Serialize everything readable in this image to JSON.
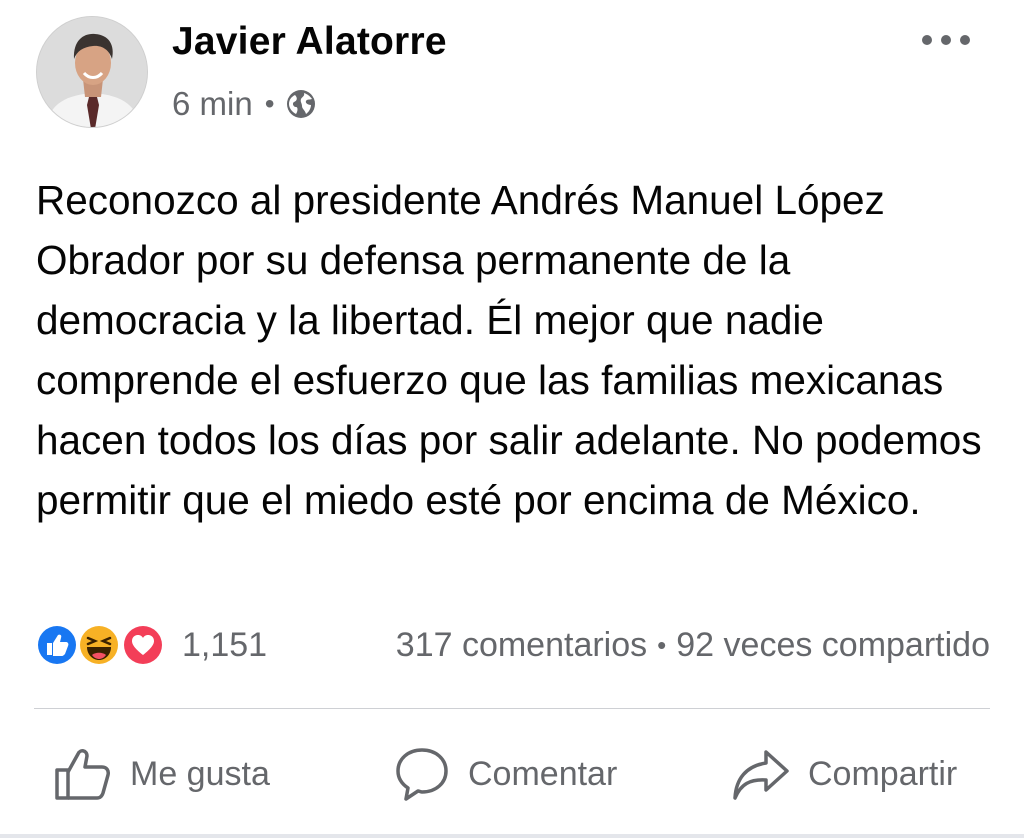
{
  "post": {
    "author": "Javier Alatorre",
    "timestamp": "6 min",
    "meta_separator": "•",
    "audience_icon": "globe-icon",
    "more_icon": "more-horizontal-icon",
    "text": "Reconozco al presidente Andrés Manuel López Obrador por su defensa permanente de la democracia y la libertad. Él mejor que nadie comprende el esfuerzo que las familias mexicanas hacen todos los días por salir adelante. No podemos permitir que el miedo esté por encima de México."
  },
  "stats": {
    "reaction_icons": [
      "like-icon",
      "haha-icon",
      "love-icon"
    ],
    "reaction_count": "1,151",
    "comments": "317 comentarios",
    "separator": "•",
    "shares": "92 veces compartido"
  },
  "actions": {
    "like_label": "Me gusta",
    "comment_label": "Comentar",
    "share_label": "Compartir"
  },
  "colors": {
    "like_blue": "#1877f2",
    "haha_yellow": "#f7b125",
    "love_red": "#f33e58",
    "secondary_text": "#65676b"
  }
}
